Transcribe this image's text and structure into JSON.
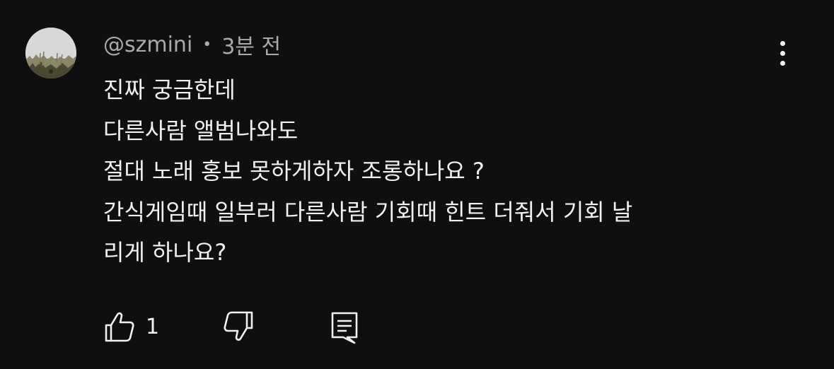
{
  "comment": {
    "author": "@szmini",
    "separator": "•",
    "timestamp": "3분 전",
    "lines": [
      "진짜 궁금한데",
      "다른사람 앨범나와도",
      "절대 노래 홍보 못하게하자 조롱하나요 ?",
      "간식게임때 일부러 다른사람 기회때 힌트 더줘서 기회 날",
      "리게 하나요?"
    ],
    "like_count": "1"
  },
  "icons": {
    "menu": "vertical-ellipsis-icon",
    "like": "thumbs-up-icon",
    "dislike": "thumbs-down-icon",
    "reply": "comment-reply-icon"
  },
  "colors": {
    "background": "#0f0f0f",
    "text_primary": "#f1f1f1",
    "text_secondary": "#aaaaaa"
  }
}
